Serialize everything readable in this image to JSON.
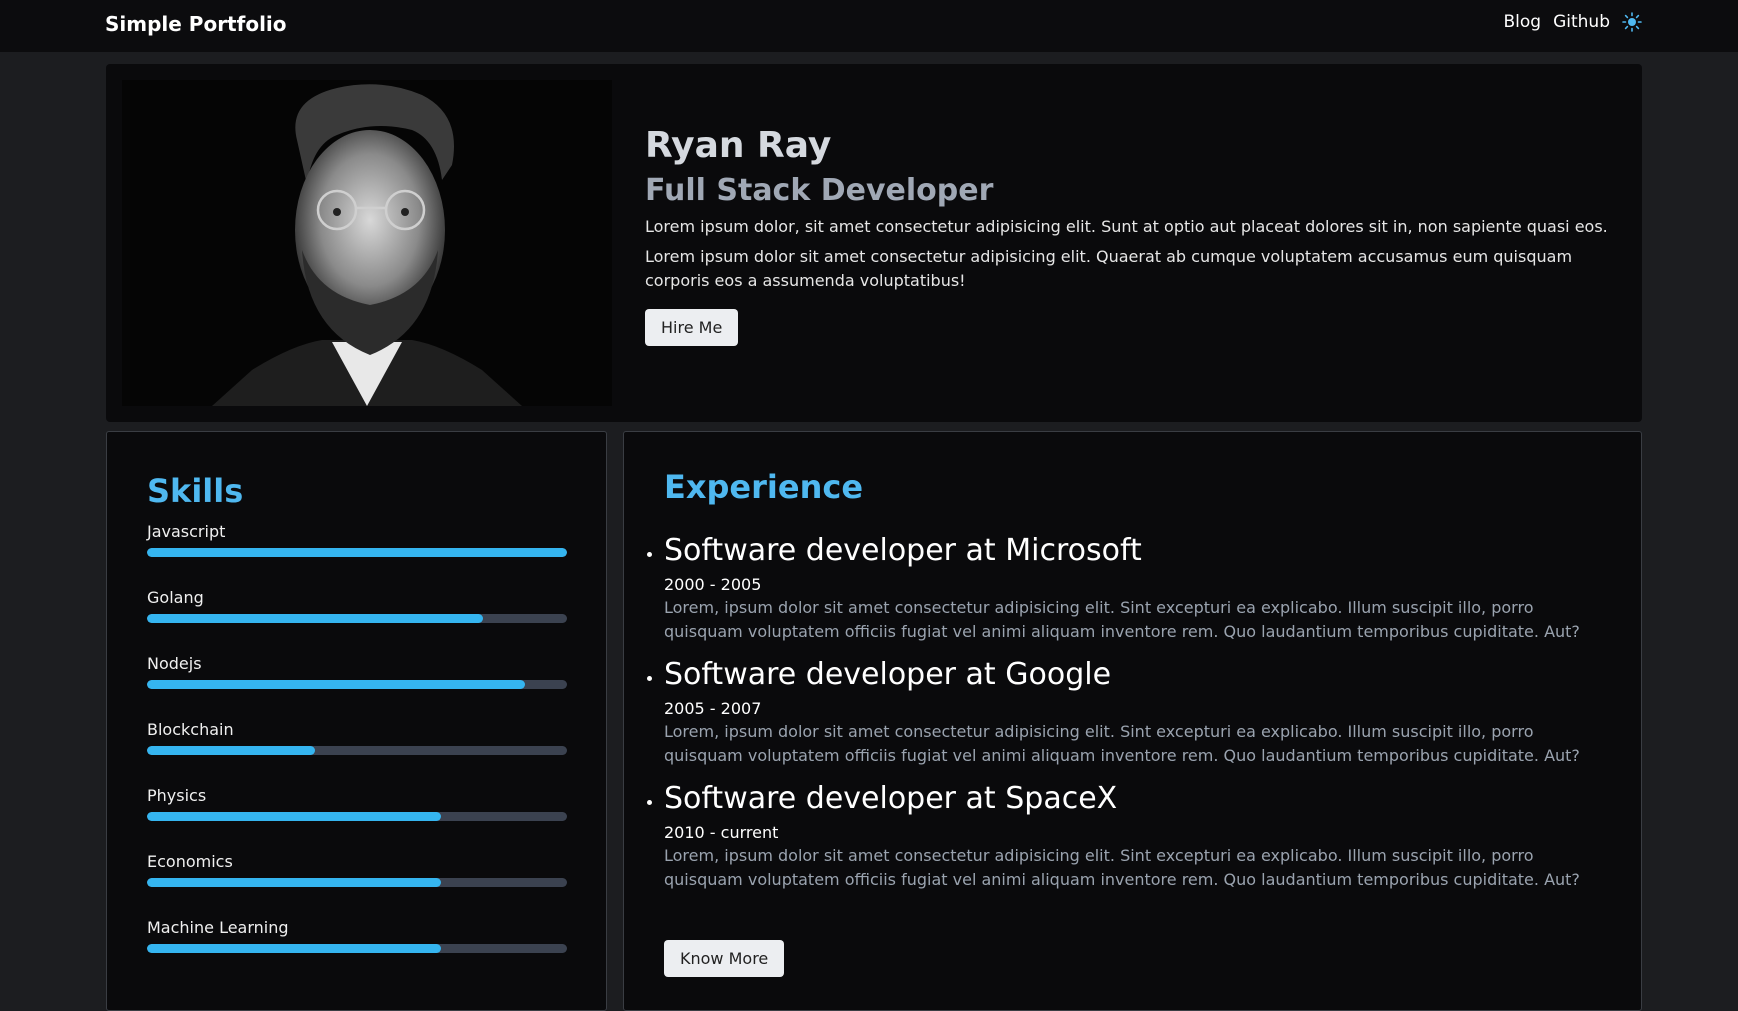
{
  "header": {
    "brand": "Simple Portfolio",
    "nav": [
      "Blog",
      "Github"
    ],
    "theme_icon": "sun-icon",
    "accent": "#4fb8f0"
  },
  "hero": {
    "name": "Ryan Ray",
    "role": "Full Stack Developer",
    "bio": [
      "Lorem ipsum dolor, sit amet consectetur adipisicing elit. Sunt at optio aut placeat dolores sit in, non sapiente quasi eos.",
      "Lorem ipsum dolor sit amet consectetur adipisicing elit. Quaerat ab cumque voluptatem accusamus eum quisquam corporis eos a assumenda voluptatibus!"
    ],
    "hire_label": "Hire Me"
  },
  "skills": {
    "title": "Skills",
    "items": [
      {
        "label": "Javascript",
        "level": 100
      },
      {
        "label": "Golang",
        "level": 80
      },
      {
        "label": "Nodejs",
        "level": 90
      },
      {
        "label": "Blockchain",
        "level": 40
      },
      {
        "label": "Physics",
        "level": 70
      },
      {
        "label": "Economics",
        "level": 70
      },
      {
        "label": "Machine Learning",
        "level": 70
      }
    ]
  },
  "experience": {
    "title": "Experience",
    "items": [
      {
        "title": "Software developer at Microsoft",
        "dates": "2000 - 2005",
        "desc": "Lorem, ipsum dolor sit amet consectetur adipisicing elit. Sint excepturi ea explicabo. Illum suscipit illo, porro quisquam voluptatem officiis fugiat vel animi aliquam inventore rem. Quo laudantium temporibus cupiditate. Aut?"
      },
      {
        "title": "Software developer at Google",
        "dates": "2005 - 2007",
        "desc": "Lorem, ipsum dolor sit amet consectetur adipisicing elit. Sint excepturi ea explicabo. Illum suscipit illo, porro quisquam voluptatem officiis fugiat vel animi aliquam inventore rem. Quo laudantium temporibus cupiditate. Aut?"
      },
      {
        "title": "Software developer at SpaceX",
        "dates": "2010 - current",
        "desc": "Lorem, ipsum dolor sit amet consectetur adipisicing elit. Sint excepturi ea explicabo. Illum suscipit illo, porro quisquam voluptatem officiis fugiat vel animi aliquam inventore rem. Quo laudantium temporibus cupiditate. Aut?"
      }
    ],
    "more_label": "Know More"
  }
}
